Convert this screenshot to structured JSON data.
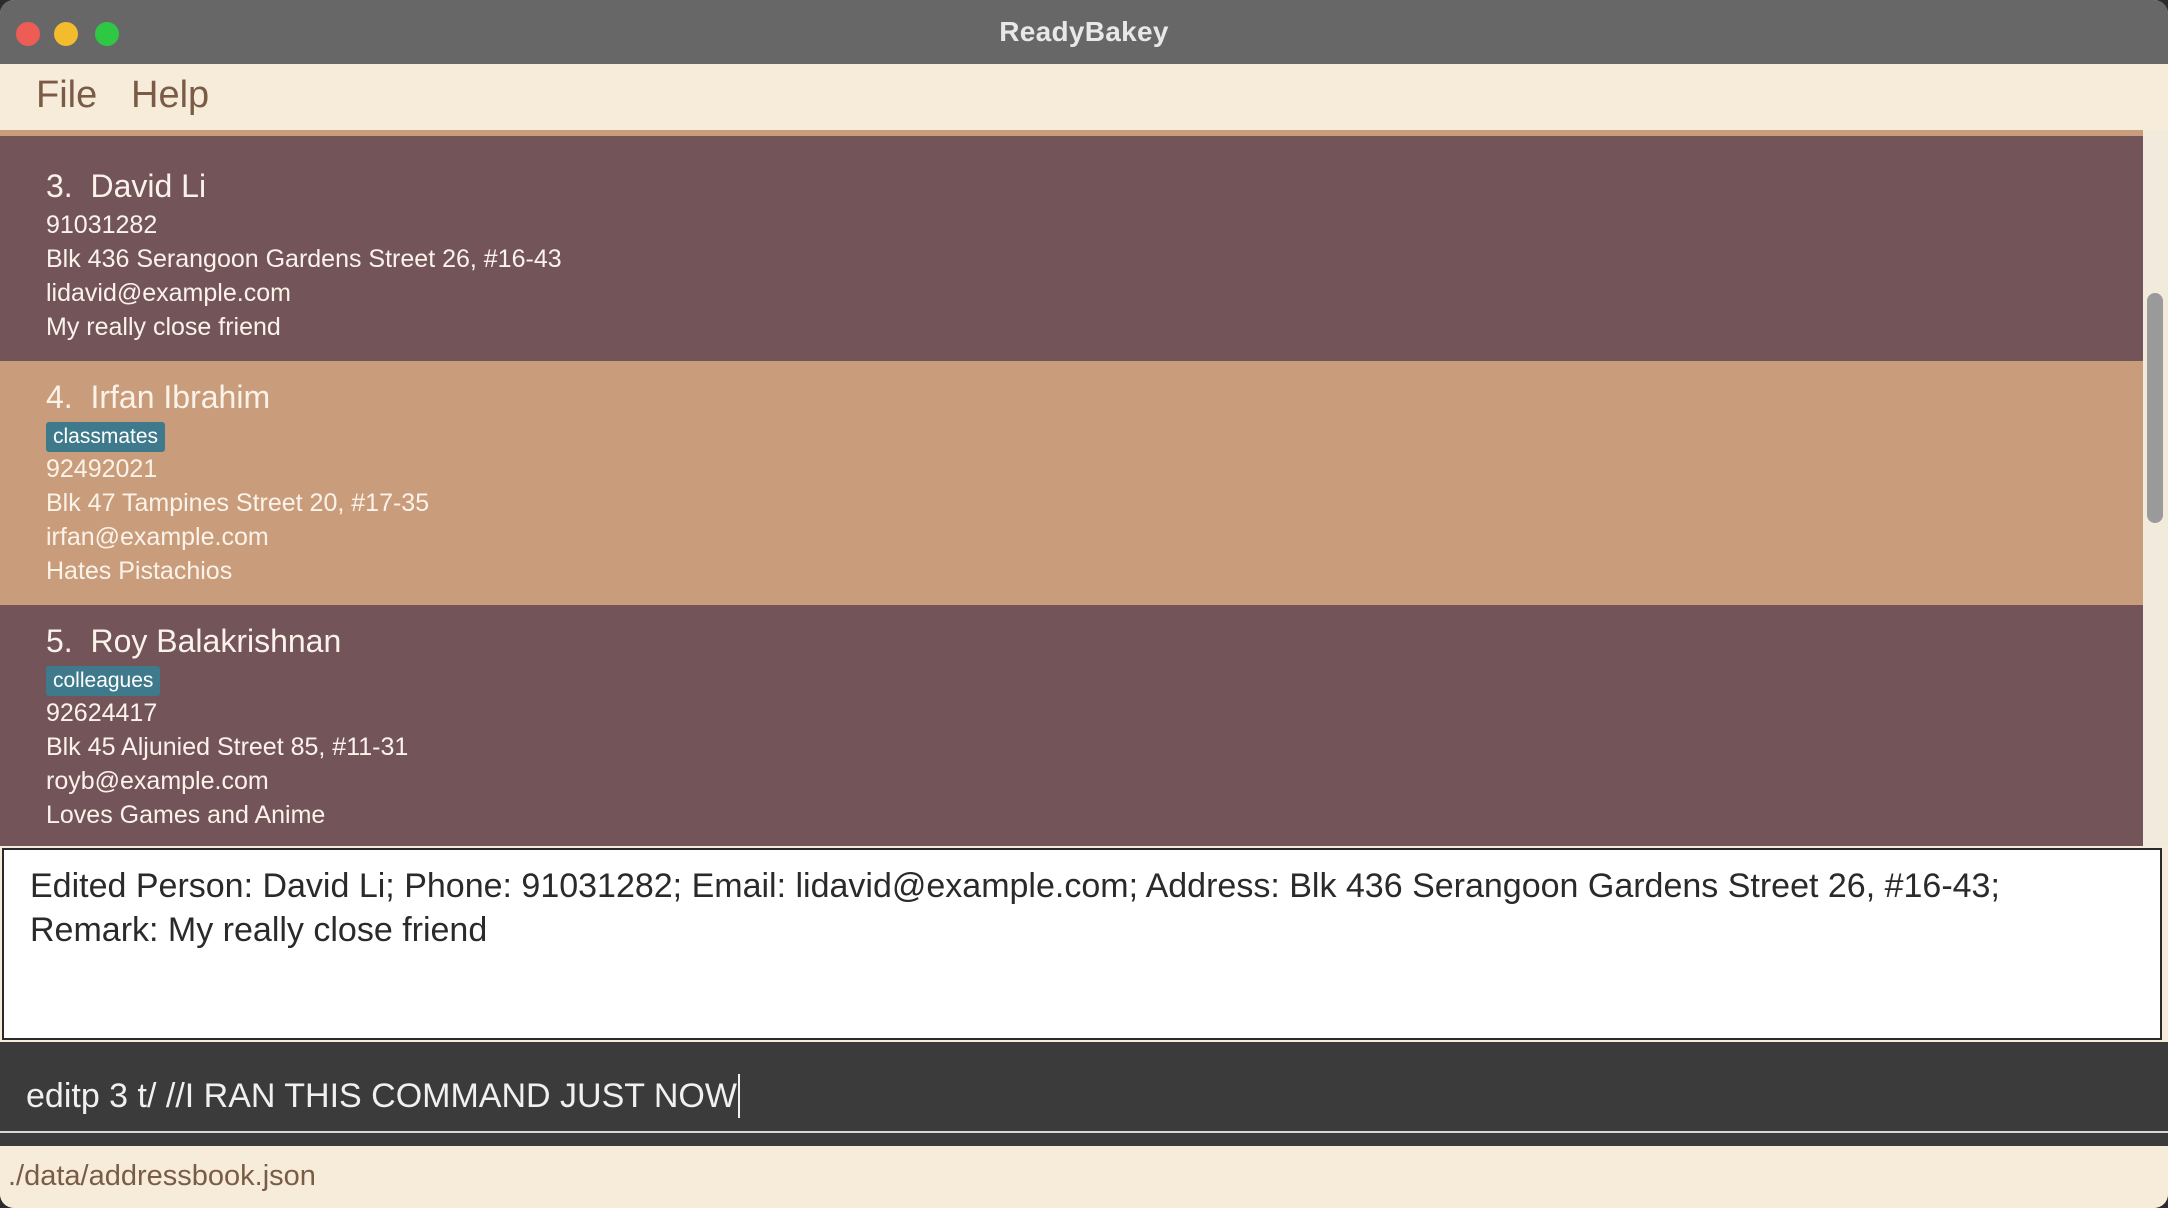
{
  "window": {
    "title": "ReadyBakey"
  },
  "menu": {
    "file": "File",
    "help": "Help"
  },
  "persons": [
    {
      "index": "3.",
      "name": "David Li",
      "tags": [],
      "phone": "91031282",
      "address": "Blk 436 Serangoon Gardens Street 26, #16-43",
      "email": "lidavid@example.com",
      "remark": "My really close friend"
    },
    {
      "index": "4.",
      "name": "Irfan Ibrahim",
      "tags": [
        "classmates"
      ],
      "phone": "92492021",
      "address": "Blk 47 Tampines Street 20, #17-35",
      "email": "irfan@example.com",
      "remark": "Hates Pistachios"
    },
    {
      "index": "5.",
      "name": "Roy Balakrishnan",
      "tags": [
        "colleagues"
      ],
      "phone": "92624417",
      "address": "Blk 45 Aljunied Street 85, #11-31",
      "email": "royb@example.com",
      "remark": "Loves Games and Anime"
    }
  ],
  "result": {
    "text": "Edited Person: David Li; Phone: 91031282; Email: lidavid@example.com; Address: Blk 436 Serangoon Gardens Street 26, #16-43; Remark: My really close friend"
  },
  "command": {
    "value": "editp 3 t/ //I RAN THIS COMMAND JUST NOW"
  },
  "status": {
    "path": "./data/addressbook.json"
  },
  "colors": {
    "card_dark": "#735559",
    "card_light": "#c99d7b",
    "tag": "#3f7a8c",
    "command_bg": "#3b3b3b",
    "menu_bg": "#f7ecd9"
  }
}
